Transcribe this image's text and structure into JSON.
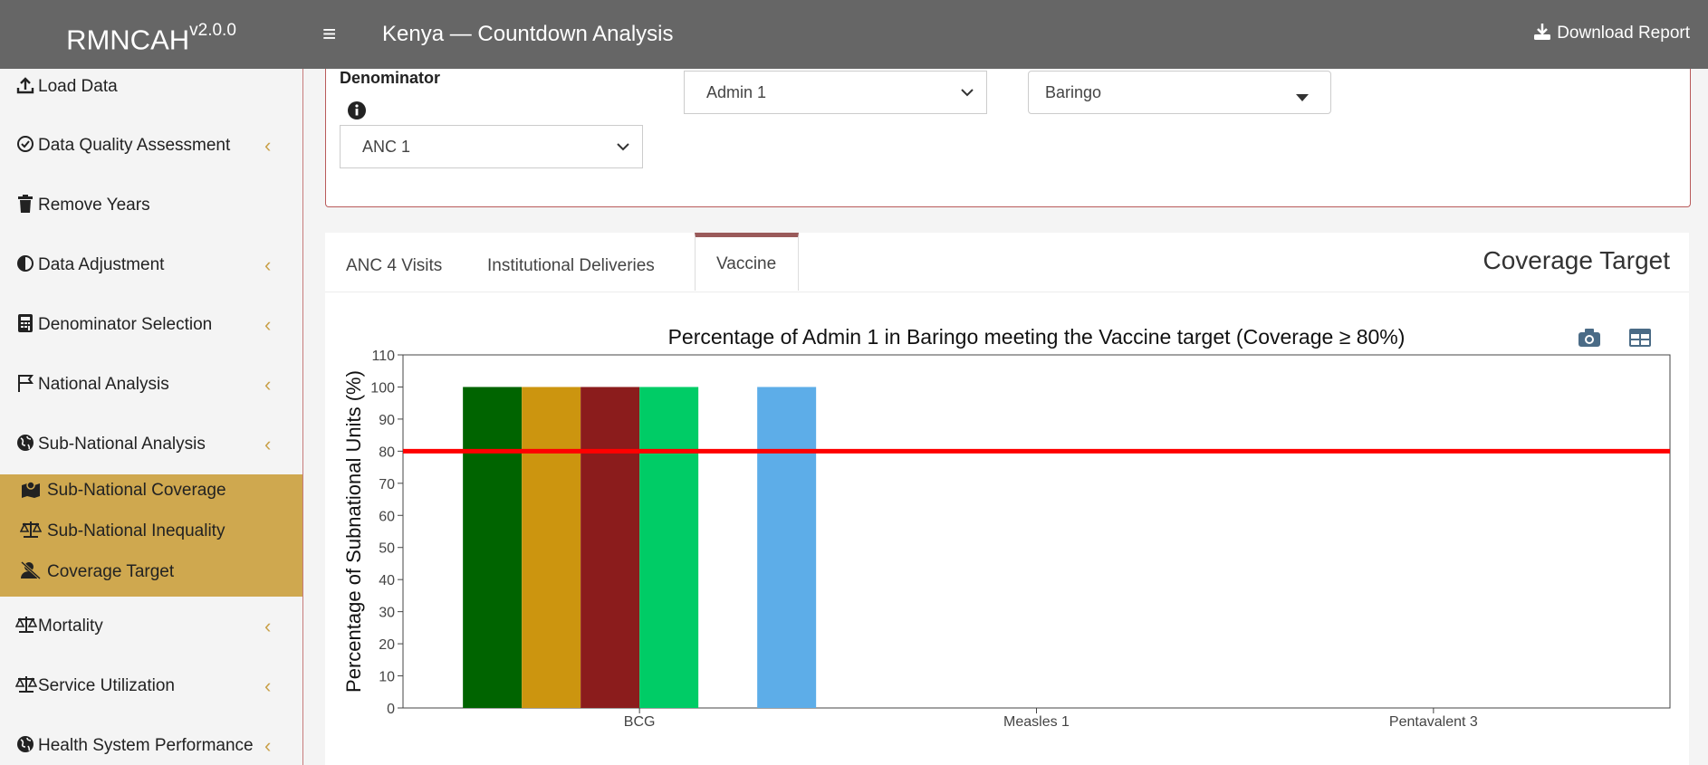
{
  "app": {
    "name": "RMNCAH",
    "version": "v2.0.0",
    "title": "Kenya — Countdown Analysis",
    "download_label": "Download Report"
  },
  "sidebar": {
    "items": [
      {
        "label": "Load Data",
        "icon": "upload-icon",
        "has_children": false
      },
      {
        "label": "Data Quality Assessment",
        "icon": "check-circle-icon",
        "has_children": true
      },
      {
        "label": "Remove Years",
        "icon": "trash-icon",
        "has_children": false
      },
      {
        "label": "Data Adjustment",
        "icon": "half-circle-icon",
        "has_children": true
      },
      {
        "label": "Denominator Selection",
        "icon": "calculator-icon",
        "has_children": true
      },
      {
        "label": "National Analysis",
        "icon": "flag-icon",
        "has_children": true
      },
      {
        "label": "Sub-National Analysis",
        "icon": "globe-icon",
        "has_children": true
      },
      {
        "label": "Mortality",
        "icon": "scale-icon",
        "has_children": true
      },
      {
        "label": "Service Utilization",
        "icon": "scale-icon",
        "has_children": true
      },
      {
        "label": "Health System Performance",
        "icon": "globe-icon",
        "has_children": true
      }
    ],
    "subitems": [
      {
        "label": "Sub-National Coverage",
        "icon": "map-icon"
      },
      {
        "label": "Sub-National Inequality",
        "icon": "scale-icon"
      },
      {
        "label": "Coverage Target",
        "icon": "user-slash-icon"
      }
    ]
  },
  "filters": {
    "denominator_label": "Denominator",
    "denominator_value": "ANC 1",
    "admin_level_value": "Admin 1",
    "region_value": "Baringo"
  },
  "tabs": [
    "ANC 4 Visits",
    "Institutional Deliveries",
    "Vaccine"
  ],
  "active_tab": "Vaccine",
  "panel_title": "Coverage Target",
  "colors": {
    "topbar": "#666666",
    "submenu": "#cfa84f",
    "accent": "#c9a14a",
    "target_line": "#ff0000"
  },
  "chart_data": {
    "type": "bar",
    "title": "Percentage of Admin 1 in Baringo meeting the Vaccine target (Coverage ≥ 80%)",
    "ylabel": "Percentage of Subnational Units (%)",
    "xlabel": "",
    "categories": [
      "BCG",
      "Measles 1",
      "Pentavalent 3"
    ],
    "ylim": [
      0,
      110
    ],
    "yticks": [
      0,
      10,
      20,
      30,
      40,
      50,
      60,
      70,
      80,
      90,
      100,
      110
    ],
    "target": 80,
    "grid": false,
    "series": [
      {
        "color": "#006400",
        "values": [
          100,
          null,
          null
        ]
      },
      {
        "color": "#cc950f",
        "values": [
          100,
          null,
          null
        ]
      },
      {
        "color": "#8b1c1c",
        "values": [
          100,
          null,
          null
        ]
      },
      {
        "color": "#00cc66",
        "values": [
          100,
          null,
          null
        ]
      },
      {
        "color": "#ffffff",
        "values": [
          null,
          null,
          null
        ]
      },
      {
        "color": "#5dade8",
        "values": [
          100,
          null,
          null
        ]
      }
    ]
  }
}
